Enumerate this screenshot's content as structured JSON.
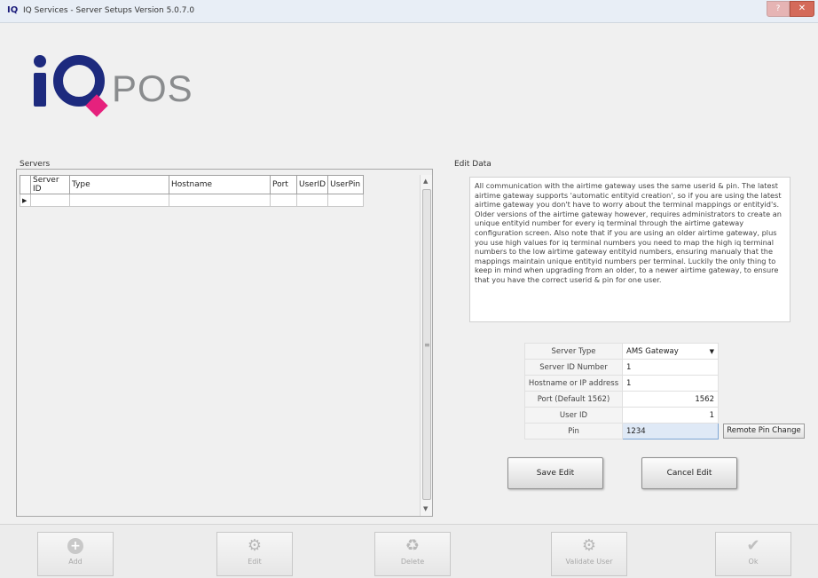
{
  "window": {
    "app_icon": "IQ",
    "title": "IQ Services - Server Setups Version 5.0.7.0",
    "help_label": "?",
    "close_label": "✕"
  },
  "logo": {
    "text": "POS"
  },
  "servers": {
    "section_label": "Servers",
    "columns": [
      "Server ID",
      "Type",
      "Hostname",
      "Port",
      "UserID",
      "UserPin"
    ],
    "row_indicator": "▶"
  },
  "edit": {
    "section_label": "Edit Data",
    "info_text": "All communication with the airtime gateway uses the same userid & pin. The latest airtime gateway supports 'automatic entityid creation', so if you are using the latest airtime gateway you don't have to worry about the terminal mappings or entityid's. Older versions of the airtime gateway however, requires administrators to create an unique entityid number for every iq terminal through the airtime gateway configuration screen. Also note that if you are using an older airtime gateway, plus you use high values for iq terminal numbers you need to map the high iq terminal numbers to the low airtime gateway entityid numbers, ensuring manualy that the mappings maintain unique entityid numbers per terminal. Luckily the only thing to keep in mind when upgrading from an older, to a newer airtime gateway, to ensure that you have the correct userid & pin for one user.",
    "fields": {
      "server_type": {
        "label": "Server Type",
        "value": "AMS Gateway"
      },
      "server_id": {
        "label": "Server ID Number",
        "value": "1"
      },
      "hostname": {
        "label": "Hostname or IP address",
        "value": "1"
      },
      "port": {
        "label": "Port (Default 1562)",
        "value": "1562"
      },
      "user_id": {
        "label": "User ID",
        "value": "1"
      },
      "pin": {
        "label": "Pin",
        "value": "1234"
      }
    },
    "remote_pin_button": "Remote Pin Change",
    "save_button": "Save Edit",
    "cancel_button": "Cancel Edit"
  },
  "toolbar": {
    "add": "Add",
    "edit": "Edit",
    "delete": "Delete",
    "validate_user": "Validate User",
    "ok": "Ok"
  },
  "icons": {
    "add": "plus-circle-icon",
    "edit": "gear-icon",
    "delete": "recycle-bin-icon",
    "validate": "gear-icon",
    "ok": "checkmark-icon",
    "dropdown": "chevron-down-icon"
  },
  "colors": {
    "brand_navy": "#1d2a7e",
    "brand_pink": "#e6217d",
    "logo_gray": "#8a8c8e",
    "close_red": "#d46a5a",
    "pin_highlight": "#dfe9f6"
  }
}
